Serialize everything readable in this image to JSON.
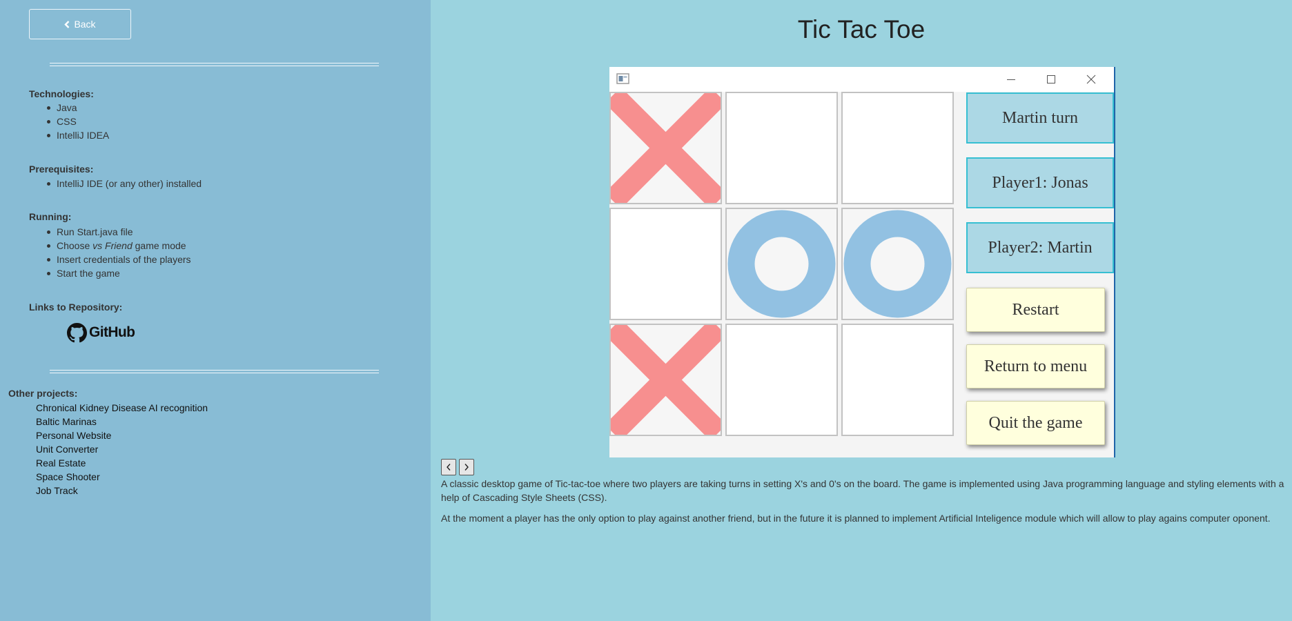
{
  "sidebar": {
    "back_label": "Back",
    "technologies": {
      "title": "Technologies:",
      "items": [
        "Java",
        "CSS",
        "IntelliJ IDEA"
      ]
    },
    "prerequisites": {
      "title": "Prerequisites:",
      "items": [
        "IntelliJ IDE (or any other) installed"
      ]
    },
    "running": {
      "title": "Running:",
      "item1": "Run Start.java file",
      "item2_prefix": "Choose ",
      "item2_em": "vs Friend",
      "item2_suffix": " game mode",
      "item3": "Insert credentials of the players",
      "item4": "Start the game"
    },
    "links": {
      "title": "Links to Repository:",
      "github_label": "GitHub"
    },
    "other": {
      "title": "Other projects:",
      "items": [
        "Chronical Kidney Disease AI recognition",
        "Baltic Marinas",
        "Personal Website",
        "Unit Converter",
        "Real Estate",
        "Space Shooter",
        "Job Track"
      ]
    }
  },
  "main": {
    "title": "Tic Tac Toe",
    "game": {
      "board": [
        "X",
        "",
        "",
        "",
        "O",
        "O",
        "X",
        "",
        ""
      ],
      "turn_label": "Martin turn",
      "player1_label": "Player1: Jonas",
      "player2_label": "Player2: Martin",
      "restart_label": "Restart",
      "menu_label": "Return to menu",
      "quit_label": "Quit the game"
    },
    "description": [
      "A classic desktop game of Tic-tac-toe where two players are taking turns in setting X's and 0's on the board. The game is implemented using Java programming language and styling elements with a help of Cascading Style Sheets (CSS).",
      "At the moment a player has the only option to play against another friend, but in the future it is planned to implement Artificial Inteligence module which will allow to play agains computer oponent."
    ]
  },
  "colors": {
    "sidebar_bg": "#88bcd5",
    "main_bg": "#9bd3df",
    "x_mark": "#f78f8f",
    "o_mark": "#92c1e2",
    "label_bg": "#acd8e5",
    "label_border": "#36bfd2",
    "button_bg": "#ffffdd"
  },
  "icons": {
    "back": "chevron-left-icon",
    "github": "github-icon",
    "app": "java-app-icon",
    "minimize": "minimize-icon",
    "maximize": "maximize-icon",
    "close": "close-icon",
    "prev": "chevron-left-icon",
    "next": "chevron-right-icon"
  }
}
